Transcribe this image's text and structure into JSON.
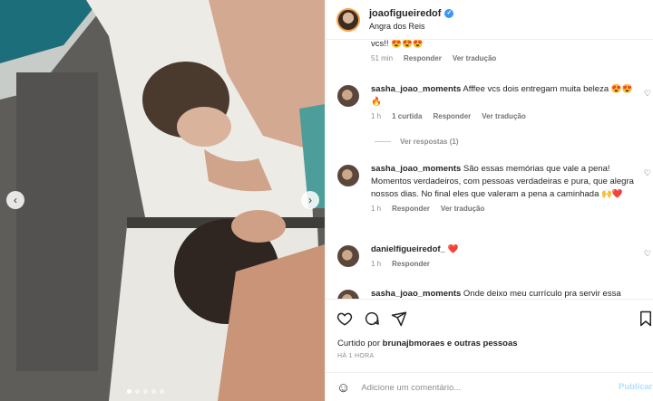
{
  "post": {
    "username": "joaofigueiredof",
    "location": "Angra dos Reis"
  },
  "comments": [
    {
      "username": "",
      "text": "vcs!! 😍😍😍",
      "time": "51 min",
      "reply_label": "Responder",
      "translate_label": "Ver tradução"
    },
    {
      "username": "sasha_joao_moments",
      "text": "Afffee vcs dois entregam muita beleza 😍😍🔥",
      "time": "1 h",
      "likes": "1 curtida",
      "reply_label": "Responder",
      "translate_label": "Ver tradução",
      "view_replies": "Ver respostas (1)"
    },
    {
      "username": "sasha_joao_moments",
      "text": "São essas memórias que vale a pena! Momentos verdadeiros, com pessoas verdadeiras e pura, que alegra nossos dias. No final eles que valeram a pena a caminhada 🙌❤️",
      "time": "1 h",
      "reply_label": "Responder",
      "translate_label": "Ver tradução"
    },
    {
      "username": "danielfigueiredof_",
      "text": "❤️",
      "time": "1 h",
      "reply_label": "Responder"
    },
    {
      "username": "sasha_joao_moments",
      "text": "Onde deixo meu currículo pra servir essa"
    }
  ],
  "actions": {
    "liked_prefix": "Curtido por",
    "liked_user": "brunajbmoraes",
    "liked_suffix": "e outras pessoas",
    "time_ago": "HÁ 1 HORA",
    "comment_placeholder": "Adicione um comentário...",
    "publish_label": "Publicar"
  },
  "icons": {
    "like": "heart-icon",
    "comment": "comment-icon",
    "share": "share-icon",
    "save": "bookmark-icon",
    "emoji": "emoji-icon",
    "prev": "chevron-left-icon",
    "next": "chevron-right-icon"
  },
  "colors": {
    "verified": "#3897f0",
    "publish_disabled": "#b2dffc",
    "muted_text": "#8e8e8e"
  }
}
